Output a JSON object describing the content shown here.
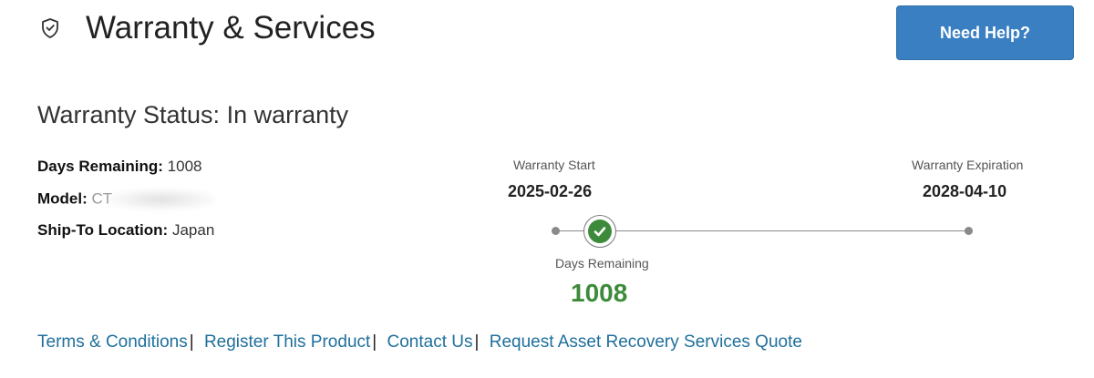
{
  "header": {
    "icon": "shield-check-icon",
    "title": "Warranty & Services",
    "help_button_label": "Need Help?"
  },
  "warranty": {
    "status_heading": "Warranty Status: In warranty",
    "details": [
      {
        "label": "Days Remaining:",
        "value": "1008"
      },
      {
        "label": "Model:",
        "value": "CT"
      },
      {
        "label": "Ship-To Location:",
        "value": "Japan"
      }
    ]
  },
  "timeline": {
    "start_caption": "Warranty Start",
    "start_date": "2025-02-26",
    "end_caption": "Warranty Expiration",
    "end_date": "2028-04-10",
    "remaining_caption": "Days Remaining",
    "remaining_value": "1008",
    "check_icon": "check-circle-icon"
  },
  "links": [
    "Terms & Conditions",
    "Register This Product",
    "Contact Us",
    "Request Asset Recovery Services Quote"
  ],
  "link_separator": "|",
  "colors": {
    "accent_button": "#3a7fc1",
    "link": "#1f6f9c",
    "success": "#3d8b3a"
  }
}
